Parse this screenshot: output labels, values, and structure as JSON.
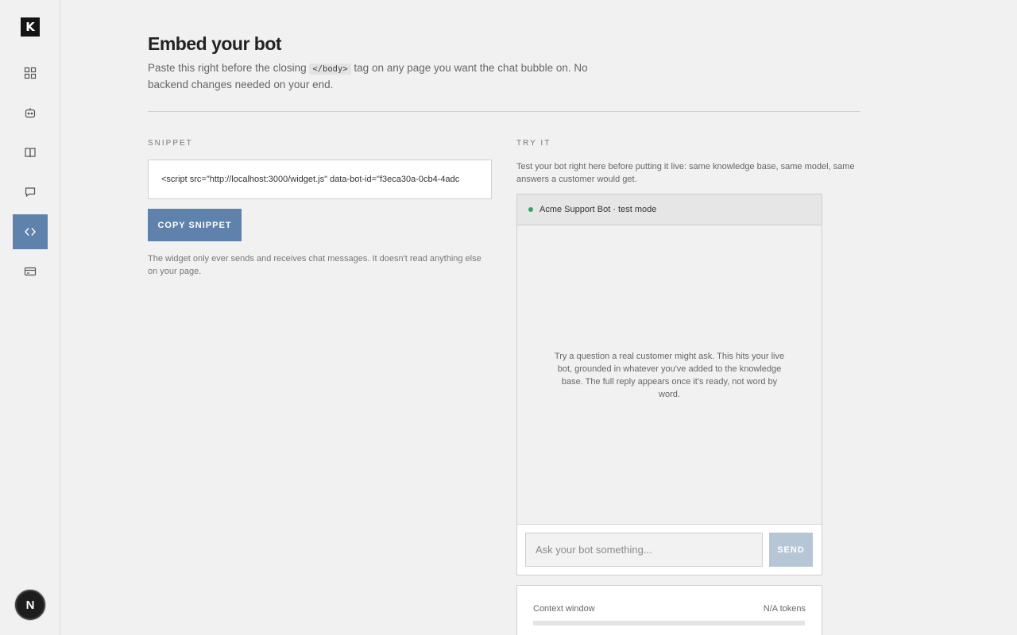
{
  "sidebar": {
    "logo": "K",
    "items": [
      {
        "name": "dashboard",
        "icon": "grid-icon"
      },
      {
        "name": "bots",
        "icon": "bot-icon"
      },
      {
        "name": "knowledge",
        "icon": "book-icon"
      },
      {
        "name": "conversations",
        "icon": "chat-icon"
      },
      {
        "name": "embed",
        "icon": "code-icon",
        "active": true
      },
      {
        "name": "billing",
        "icon": "card-icon"
      }
    ],
    "avatar": "N"
  },
  "header": {
    "title": "Embed your bot",
    "desc_before": "Paste this right before the closing",
    "desc_code": "</body>",
    "desc_after": "tag on any page you want the chat bubble on. No backend changes needed on your end."
  },
  "snippet": {
    "label": "SNIPPET",
    "code": "<script src=\"http://localhost:3000/widget.js\" data-bot-id=\"f3eca30a-0cb4-4adc",
    "copy_label": "COPY SNIPPET",
    "note": "The widget only ever sends and receives chat messages. It doesn't read anything else on your page."
  },
  "try_it": {
    "label": "TRY IT",
    "desc": "Test your bot right here before putting it live: same knowledge base, same model, same answers a customer would get.",
    "chat_title": "Acme Support Bot · test mode",
    "status_color": "#2fa66a",
    "empty_text": "Try a question a real customer might ask. This hits your live bot, grounded in whatever you've added to the knowledge base. The full reply appears once it's ready, not word by word.",
    "input_placeholder": "Ask your bot something...",
    "send_label": "SEND"
  },
  "context": {
    "label": "Context window",
    "value": "N/A tokens",
    "fill_fraction": 0
  },
  "colors": {
    "accent": "#5e82ab",
    "accent_disabled": "#b7c6d6"
  }
}
